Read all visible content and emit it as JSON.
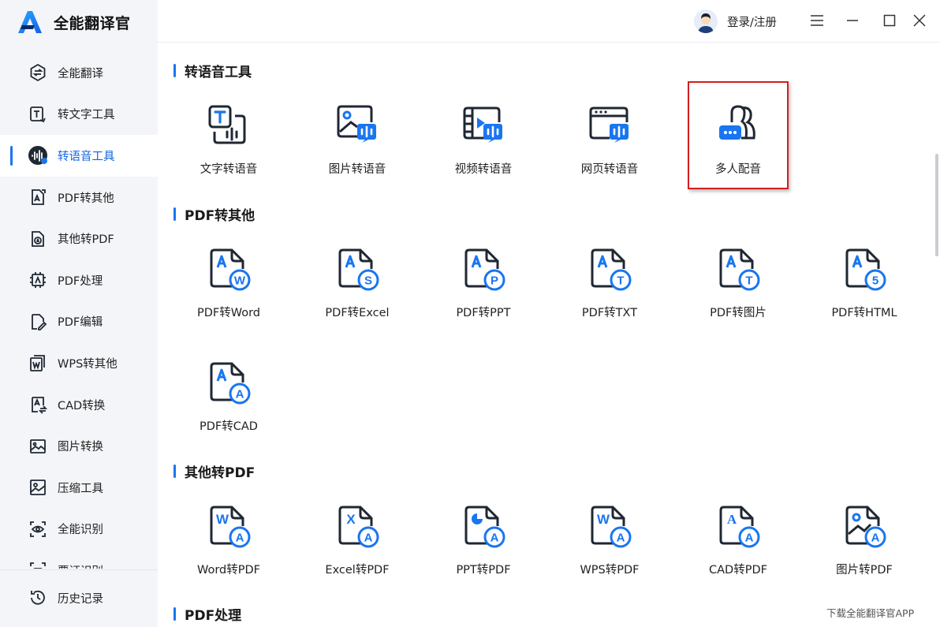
{
  "app": {
    "name": "全能翻译官"
  },
  "header": {
    "login_label": "登录/注册"
  },
  "sidebar": {
    "items": [
      {
        "label": "全能翻译",
        "icon": "translate-icon"
      },
      {
        "label": "转文字工具",
        "icon": "text-convert-icon"
      },
      {
        "label": "转语音工具",
        "icon": "voice-wave-icon",
        "active": true
      },
      {
        "label": "PDF转其他",
        "icon": "pdf-export-icon"
      },
      {
        "label": "其他转PDF",
        "icon": "pdf-import-icon"
      },
      {
        "label": "PDF处理",
        "icon": "pdf-process-icon"
      },
      {
        "label": "PDF编辑",
        "icon": "pdf-edit-icon"
      },
      {
        "label": "WPS转其他",
        "icon": "wps-icon"
      },
      {
        "label": "CAD转换",
        "icon": "cad-icon"
      },
      {
        "label": "图片转换",
        "icon": "image-convert-icon"
      },
      {
        "label": "压缩工具",
        "icon": "compress-icon"
      },
      {
        "label": "全能识别",
        "icon": "scan-eye-icon"
      },
      {
        "label": "票证识别",
        "icon": "ticket-icon"
      }
    ],
    "history": {
      "label": "历史记录",
      "icon": "history-icon"
    }
  },
  "sections": [
    {
      "title": "转语音工具",
      "tools": [
        {
          "label": "文字转语音",
          "icon": "text-to-speech-icon"
        },
        {
          "label": "图片转语音",
          "icon": "image-to-speech-icon"
        },
        {
          "label": "视频转语音",
          "icon": "video-to-speech-icon"
        },
        {
          "label": "网页转语音",
          "icon": "webpage-to-speech-icon"
        },
        {
          "label": "多人配音",
          "icon": "multi-voice-icon",
          "highlighted": true
        }
      ]
    },
    {
      "title": "PDF转其他",
      "tools": [
        {
          "label": "PDF转Word",
          "icon": "pdf-to-word-icon",
          "badge": "W"
        },
        {
          "label": "PDF转Excel",
          "icon": "pdf-to-excel-icon",
          "badge": "S"
        },
        {
          "label": "PDF转PPT",
          "icon": "pdf-to-ppt-icon",
          "badge": "P"
        },
        {
          "label": "PDF转TXT",
          "icon": "pdf-to-txt-icon",
          "badge": "T"
        },
        {
          "label": "PDF转图片",
          "icon": "pdf-to-image-icon",
          "badge": "T"
        },
        {
          "label": "PDF转HTML",
          "icon": "pdf-to-html-icon",
          "badge": "5"
        },
        {
          "label": "PDF转CAD",
          "icon": "pdf-to-cad-icon",
          "badge": "A"
        }
      ]
    },
    {
      "title": "其他转PDF",
      "tools": [
        {
          "label": "Word转PDF",
          "icon": "word-to-pdf-icon",
          "badge": "W"
        },
        {
          "label": "Excel转PDF",
          "icon": "excel-to-pdf-icon",
          "badge": "X"
        },
        {
          "label": "PPT转PDF",
          "icon": "ppt-to-pdf-icon",
          "badge": "P"
        },
        {
          "label": "WPS转PDF",
          "icon": "wps-to-pdf-icon",
          "badge": "W"
        },
        {
          "label": "CAD转PDF",
          "icon": "cad-to-pdf-icon",
          "badge": "A"
        },
        {
          "label": "图片转PDF",
          "icon": "image-to-pdf-icon",
          "badge": ""
        }
      ]
    },
    {
      "title": "PDF处理",
      "tools": []
    }
  ],
  "footer": {
    "download_label": "下载全能翻译官APP"
  },
  "colors": {
    "accent": "#1976f0",
    "dark": "#1f2733",
    "highlight_border": "#d21f1f",
    "sidebar_bg": "#f3f5f8"
  }
}
